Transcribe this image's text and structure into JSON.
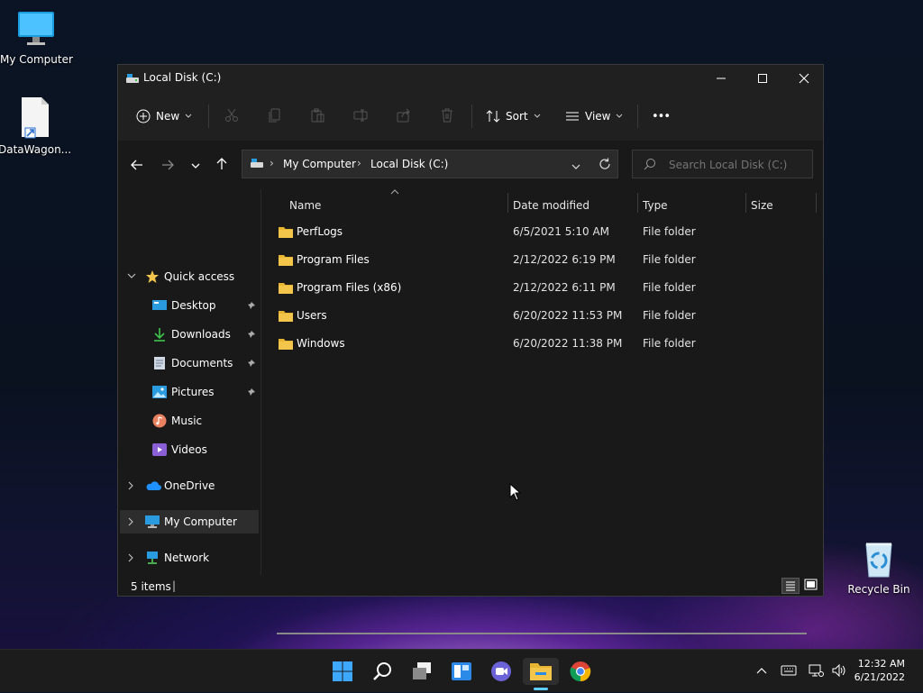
{
  "desktop": {
    "icons": [
      {
        "label": "My Computer"
      },
      {
        "label": "DataWagon..."
      },
      {
        "label": "Recycle Bin"
      }
    ]
  },
  "window": {
    "title": "Local Disk (C:)",
    "toolbar": {
      "new_label": "New",
      "sort_label": "Sort",
      "view_label": "View",
      "more_label": "•••"
    },
    "address": {
      "crumbs": [
        "My Computer",
        "Local Disk (C:)"
      ],
      "separator": "›"
    },
    "search": {
      "placeholder": "Search Local Disk (C:)"
    },
    "sidebar": {
      "quick_access": "Quick access",
      "items": [
        {
          "label": "Desktop",
          "icon": "desktop-icon",
          "pinned": true
        },
        {
          "label": "Downloads",
          "icon": "download-icon",
          "pinned": true
        },
        {
          "label": "Documents",
          "icon": "document-icon",
          "pinned": true
        },
        {
          "label": "Pictures",
          "icon": "pictures-icon",
          "pinned": true
        },
        {
          "label": "Music",
          "icon": "music-icon",
          "pinned": false
        },
        {
          "label": "Videos",
          "icon": "videos-icon",
          "pinned": false
        }
      ],
      "onedrive": "OneDrive",
      "my_computer": "My Computer",
      "network": "Network"
    },
    "columns": {
      "name": "Name",
      "date": "Date modified",
      "type": "Type",
      "size": "Size"
    },
    "rows": [
      {
        "name": "PerfLogs",
        "date": "6/5/2021 5:10 AM",
        "type": "File folder",
        "size": ""
      },
      {
        "name": "Program Files",
        "date": "2/12/2022 6:19 PM",
        "type": "File folder",
        "size": ""
      },
      {
        "name": "Program Files (x86)",
        "date": "2/12/2022 6:11 PM",
        "type": "File folder",
        "size": ""
      },
      {
        "name": "Users",
        "date": "6/20/2022 11:53 PM",
        "type": "File folder",
        "size": ""
      },
      {
        "name": "Windows",
        "date": "6/20/2022 11:38 PM",
        "type": "File folder",
        "size": ""
      }
    ],
    "status": {
      "items_count": "5 items",
      "separator": "|"
    }
  },
  "taskbar": {
    "clock_time": "12:32 AM",
    "clock_date": "6/21/2022",
    "apps": [
      "start-icon",
      "search-icon",
      "task-view-icon",
      "widgets-icon",
      "chat-icon",
      "file-explorer-icon",
      "chrome-icon"
    ]
  },
  "colors": {
    "folder": "#f3c54b",
    "accent": "#60cdff",
    "window_bg": "#191919",
    "toolbar_bg": "#202020",
    "taskbar_bg": "#1c1c1c"
  }
}
